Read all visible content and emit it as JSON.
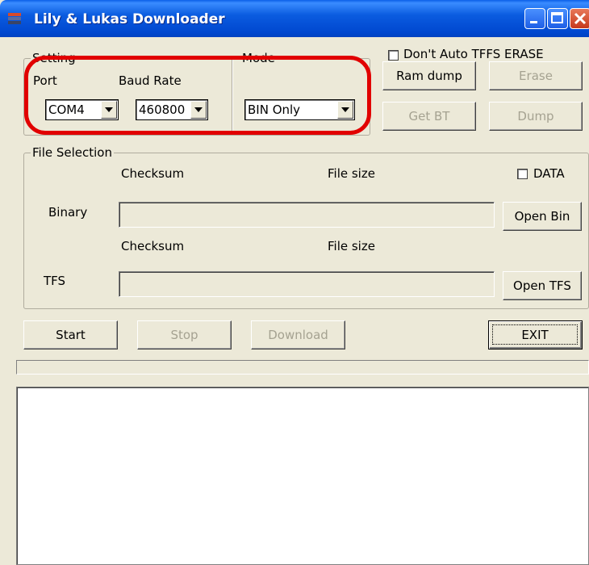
{
  "window": {
    "title": "Lily & Lukas Downloader",
    "icons": {
      "app": "downloader-app-icon",
      "minimize": "minimize-icon",
      "maximize": "maximize-icon",
      "close": "close-icon"
    }
  },
  "setting": {
    "group_label": "Setting",
    "port_label": "Port",
    "baud_label": "Baud Rate",
    "port_value": "COM4",
    "baud_value": "460800"
  },
  "mode": {
    "group_label": "Mode",
    "value": "BIN Only"
  },
  "right_panel": {
    "auto_erase_label": "Don't Auto TFFS ERASE",
    "auto_erase_checked": false,
    "ram_dump": "Ram dump",
    "erase": "Erase",
    "get_bt": "Get BT",
    "dump": "Dump"
  },
  "file_selection": {
    "group_label": "File Selection",
    "checksum_label": "Checksum",
    "filesize_label": "File size",
    "data_label": "DATA",
    "data_checked": false,
    "binary_label": "Binary",
    "binary_value": "",
    "open_bin": "Open Bin",
    "tfs_label": "TFS",
    "tfs_value": "",
    "open_tfs": "Open TFS"
  },
  "actions": {
    "start": "Start",
    "stop": "Stop",
    "download": "Download",
    "exit": "EXIT"
  },
  "colors": {
    "highlight": "#E10000",
    "titlebar": "#0047CF",
    "face": "#ECE9D8",
    "disabled_text": "#A5A291"
  }
}
